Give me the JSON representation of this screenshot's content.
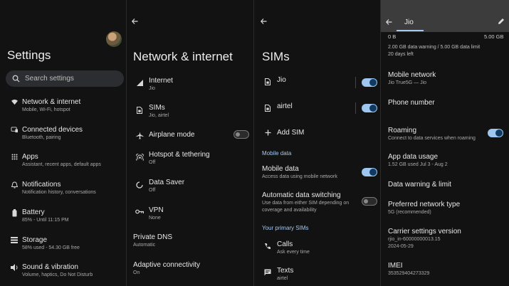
{
  "settings": {
    "title": "Settings",
    "search_placeholder": "Search settings",
    "items": [
      {
        "title": "Network & internet",
        "subtitle": "Mobile, Wi-Fi, hotspot",
        "icon": "wifi-icon"
      },
      {
        "title": "Connected devices",
        "subtitle": "Bluetooth, pairing",
        "icon": "devices-icon"
      },
      {
        "title": "Apps",
        "subtitle": "Assistant, recent apps, default apps",
        "icon": "apps-grid-icon"
      },
      {
        "title": "Notifications",
        "subtitle": "Notification history, conversations",
        "icon": "bell-icon"
      },
      {
        "title": "Battery",
        "subtitle": "85% - Until 11:15 PM",
        "icon": "battery-icon"
      },
      {
        "title": "Storage",
        "subtitle": "58% used - 54.30 GB free",
        "icon": "storage-icon"
      },
      {
        "title": "Sound & vibration",
        "subtitle": "Volume, haptics, Do Not Disturb",
        "icon": "volume-icon"
      }
    ]
  },
  "network": {
    "title": "Network & internet",
    "items": [
      {
        "title": "Internet",
        "subtitle": "Jio",
        "icon": "signal-icon"
      },
      {
        "title": "SIMs",
        "subtitle": "Jio, airtel",
        "icon": "sim-icon"
      },
      {
        "title": "Airplane mode",
        "subtitle": "",
        "icon": "airplane-icon",
        "toggle": "off"
      },
      {
        "title": "Hotspot & tethering",
        "subtitle": "Off",
        "icon": "hotspot-icon"
      },
      {
        "title": "Data Saver",
        "subtitle": "Off",
        "icon": "data-saver-icon"
      },
      {
        "title": "VPN",
        "subtitle": "None",
        "icon": "vpn-icon"
      },
      {
        "title": "Private DNS",
        "subtitle": "Automatic"
      },
      {
        "title": "Adaptive connectivity",
        "subtitle": "On"
      }
    ]
  },
  "sims": {
    "title": "SIMs",
    "sim_list": [
      {
        "name": "Jio",
        "toggle": "on"
      },
      {
        "name": "airtel",
        "toggle": "on"
      }
    ],
    "add_sim": "Add SIM",
    "mobile_data_header": "Mobile data",
    "mobile_data": {
      "title": "Mobile data",
      "subtitle": "Access data using mobile network",
      "toggle": "on"
    },
    "auto_switch": {
      "title": "Automatic data switching",
      "subtitle_1": "Use data from either SIM depending on",
      "subtitle_2": "coverage and availability",
      "toggle": "off"
    },
    "primary_header": "Your primary SIMs",
    "calls": {
      "title": "Calls",
      "subtitle": "Ask every time"
    },
    "texts": {
      "title": "Texts",
      "subtitle": "airtel"
    }
  },
  "jio": {
    "tab": "Jio",
    "scale_left": "0 B",
    "scale_right": "5.00 GB",
    "warning": "2.00 GB data warning / 5.00 GB data limit",
    "days_left": "20 days left",
    "items": [
      {
        "title": "Mobile network",
        "subtitle": "Jio True5G — Jio"
      },
      {
        "title": "Phone number",
        "subtitle": ""
      },
      {
        "title": "Roaming",
        "subtitle": "Connect to data services when roaming",
        "toggle": "on"
      },
      {
        "title": "App data usage",
        "subtitle": "1.52 GB used Jul 3 - Aug 2"
      },
      {
        "title": "Data warning & limit",
        "subtitle": ""
      },
      {
        "title": "Preferred network type",
        "subtitle": "5G (recommended)"
      },
      {
        "title": "Carrier settings version",
        "subtitle": "rjio_in-60000000013.15",
        "subtitle_2": "2024-05-29"
      },
      {
        "title": "IMEI",
        "subtitle": "353529404273329"
      }
    ]
  },
  "colors": {
    "accent": "#a6c8f0",
    "toggle_on": "#9ec6ee",
    "background": "#121212"
  }
}
